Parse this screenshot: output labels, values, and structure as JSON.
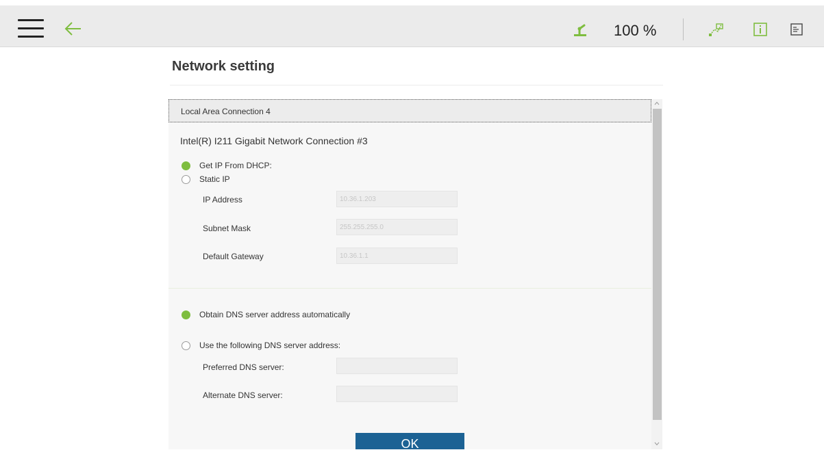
{
  "colors": {
    "accent_green": "#7ebd3f",
    "button_blue": "#1c6294",
    "topbar_bg": "#ebebeb"
  },
  "topbar": {
    "menu_icon": "hamburger-menu-icon",
    "back_icon": "back-arrow-icon",
    "robot_icon": "robot-arm-icon",
    "zoom_label": "100 %",
    "network_icon": "network-status-icon",
    "info_icon": "info-icon",
    "panel_icon": "panel-toggle-icon"
  },
  "page": {
    "title": "Network setting"
  },
  "connection": {
    "header": "Local Area Connection 4",
    "adapter": "Intel(R) I211 Gigabit Network Connection #3"
  },
  "ip_mode": {
    "dhcp_label": "Get IP From DHCP:",
    "static_label": "Static IP",
    "selected": "dhcp"
  },
  "ip_fields": [
    {
      "label": "IP Address",
      "value": "10.36.1.203"
    },
    {
      "label": "Subnet Mask",
      "value": "255.255.255.0"
    },
    {
      "label": "Default Gateway",
      "value": "10.36.1.1"
    }
  ],
  "dns_mode": {
    "auto_label": "Obtain DNS server address automatically",
    "manual_label": "Use the following DNS server address:",
    "selected": "auto"
  },
  "dns_fields": [
    {
      "label": "Preferred DNS server:",
      "value": ""
    },
    {
      "label": "Alternate DNS server:",
      "value": ""
    }
  ],
  "ok_button": "OK"
}
